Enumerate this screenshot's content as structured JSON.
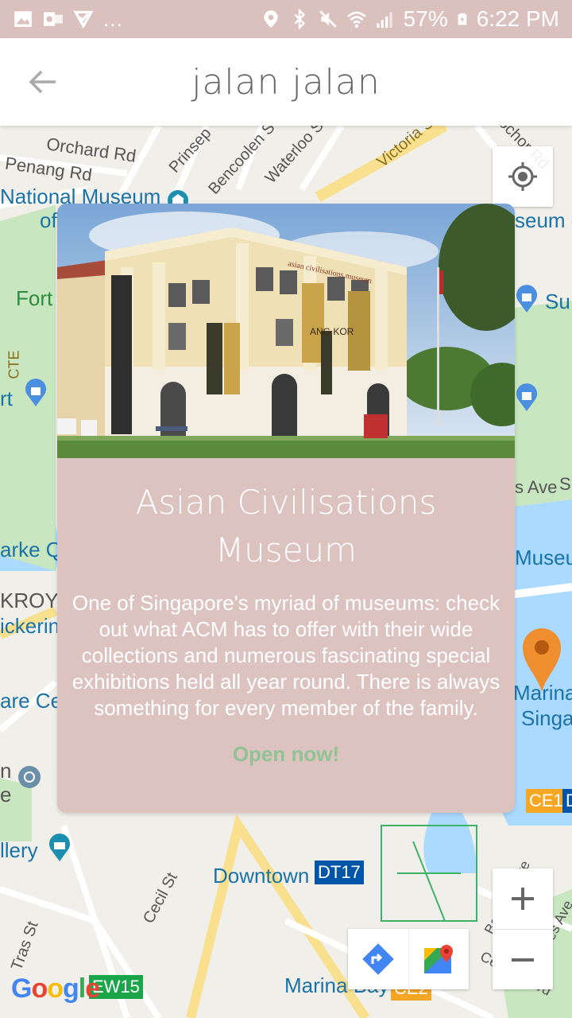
{
  "status_bar": {
    "battery": "57%",
    "time": "6:22 PM",
    "more": "...",
    "icons": [
      "gallery-icon",
      "outlook-icon",
      "tasks-icon",
      "location-icon",
      "bluetooth-icon",
      "mute-icon",
      "wifi-icon",
      "signal-icon",
      "battery-charging-icon"
    ]
  },
  "app_bar": {
    "title": "jalan jalan",
    "back_icon": "arrow-left-icon"
  },
  "map": {
    "labels": {
      "orchard": "Orchard Rd",
      "penang": "Penang Rd",
      "national_museum": "National Museum",
      "national_museum_of": "of",
      "fort": "Fort",
      "cte": "CTE",
      "rt": "rt",
      "arke": "arke Qu",
      "kroya": "KROYA",
      "ickerin": "ickerin",
      "are_ce": "are Ce",
      "n": "n",
      "e": "e",
      "llery": "llery",
      "downtown": "Downtown",
      "dt17": "DT17",
      "cecil": "Cecil St",
      "tras": "Tras St",
      "ew15": "EW15",
      "marina_bay": "Marina Bay",
      "ce2": "CE2",
      "ce1": "CE1",
      "d": "D",
      "marina": "Marina",
      "singa": "Singa",
      "museu": "Museu",
      "s_ave": "s Ave",
      "s": "S",
      "su": "Su",
      "seum_c": "seum c",
      "prinsep": "Prinsep",
      "bencoolen": "Bencoolen S",
      "waterloo": "Waterloo S",
      "victoria": "Victoria S",
      "rochor": "Rochor Rd",
      "bayfront": "Bayfront Ave",
      "sheares": "Sheares Ave",
      "central": "Central Blvd"
    },
    "google_logo": "Google",
    "colors": {
      "water": "#aadaff",
      "park": "#c8e6c0",
      "road_major": "#f8e08e",
      "road": "#ffffff",
      "mrt_blue": "#0055a8",
      "mrt_green": "#1aa54a",
      "mrt_orange": "#f5a623"
    }
  },
  "card": {
    "title": "Asian Civilisations Museum",
    "description": "One of Singapore's myriad of museums: check out what ACM has to offer with their wide collections and numerous fascinating special exhibitions held all year round. There is always something for every member of the family.",
    "status": "Open now!",
    "photo_sign": "asian civilisations museum",
    "banner_text": "ANG KOR",
    "background": "#dcc3bf",
    "status_color": "#8fc392"
  }
}
